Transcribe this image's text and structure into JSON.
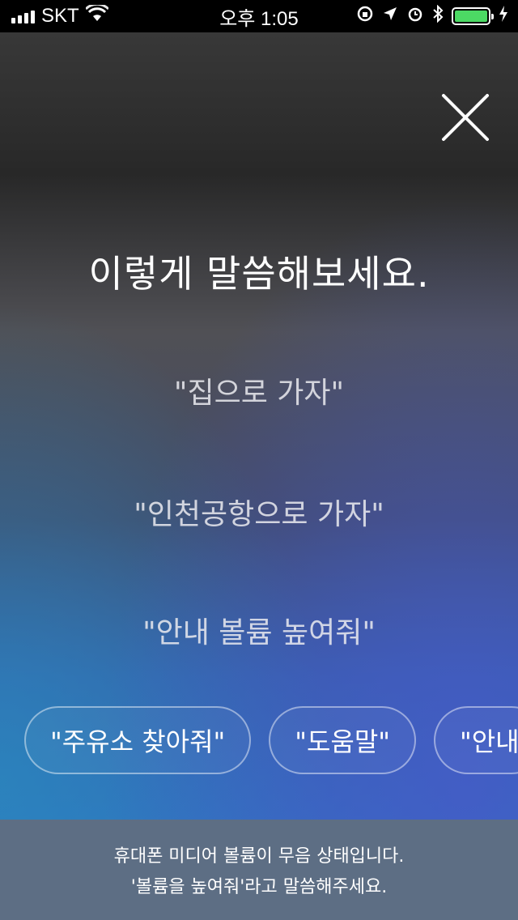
{
  "status_bar": {
    "carrier": "SKT",
    "time": "오후 1:05",
    "battery_color": "#4cd964"
  },
  "voice_guide": {
    "close_icon": "close-icon",
    "title": "이렇게 말씀해보세요.",
    "examples": [
      "\"집으로 가자\"",
      "\"인천공항으로 가자\"",
      "\"안내 볼륨 높여줘\""
    ],
    "chips": [
      "\"주유소 찾아줘\"",
      "\"도움말\"",
      "\"안내"
    ]
  },
  "toast": {
    "line1": "휴대폰 미디어 볼륨이 무음 상태입니다.",
    "line2": "'볼륨을 높여줘'라고 말씀해주세요."
  }
}
